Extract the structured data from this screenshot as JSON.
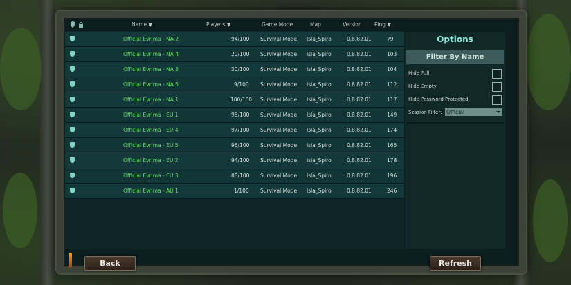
{
  "table": {
    "headers": {
      "name": "Name ▼",
      "players": "Players ▼",
      "game_mode": "Game Mode",
      "map": "Map",
      "version": "Version",
      "ping": "Ping ▼"
    },
    "rows": [
      {
        "name": "Official Evrima - NA 2",
        "players": "94/100",
        "mode": "Survival Mode",
        "map": "Isla_Spiro",
        "version": "0.8.82.01",
        "ping": "79"
      },
      {
        "name": "Official Evrima - NA 4",
        "players": "20/100",
        "mode": "Survival Mode",
        "map": "Isla_Spiro",
        "version": "0.8.82.01",
        "ping": "103"
      },
      {
        "name": "Official Evrima - NA 3",
        "players": "30/100",
        "mode": "Survival Mode",
        "map": "Isla_Spiro",
        "version": "0.8.82.01",
        "ping": "104"
      },
      {
        "name": "Official Evrima - NA 5",
        "players": "9/100",
        "mode": "Survival Mode",
        "map": "Isla_Spiro",
        "version": "0.8.82.01",
        "ping": "112"
      },
      {
        "name": "Official Evrima - NA 1",
        "players": "100/100",
        "mode": "Survival Mode",
        "map": "Isla_Spiro",
        "version": "0.8.82.01",
        "ping": "117"
      },
      {
        "name": "Official Evrima - EU 1",
        "players": "95/100",
        "mode": "Survival Mode",
        "map": "Isla_Spiro",
        "version": "0.8.82.01",
        "ping": "149"
      },
      {
        "name": "Official Evrima - EU 4",
        "players": "97/100",
        "mode": "Survival Mode",
        "map": "Isla_Spiro",
        "version": "0.8.82.01",
        "ping": "174"
      },
      {
        "name": "Official Evrima - EU 5",
        "players": "96/100",
        "mode": "Survival Mode",
        "map": "Isla_Spiro",
        "version": "0.8.82.01",
        "ping": "165"
      },
      {
        "name": "Official Evrima - EU 2",
        "players": "94/100",
        "mode": "Survival Mode",
        "map": "Isla_Spiro",
        "version": "0.8.82.01",
        "ping": "178"
      },
      {
        "name": "Official Evrima - EU 3",
        "players": "88/100",
        "mode": "Survival Mode",
        "map": "Isla_Spiro",
        "version": "0.8.82.01",
        "ping": "196"
      },
      {
        "name": "Official Evrima - AU 1",
        "players": "1/100",
        "mode": "Survival Mode",
        "map": "Isla_Spiro",
        "version": "0.8.82.01",
        "ping": "246"
      }
    ]
  },
  "options": {
    "title": "Options",
    "filter_by_name": "Filter By Name",
    "hide_full": "Hide Full:",
    "hide_empty": "Hide Empty:",
    "hide_password": "Hide Password Protected",
    "session_filter_label": "Session Filter:",
    "session_filter_value": "Official"
  },
  "buttons": {
    "back": "Back",
    "refresh": "Refresh"
  },
  "icons": {
    "shield": "shield-icon",
    "lock": "lock-icon"
  },
  "colors": {
    "server_name": "#5fe05a",
    "panel": "#0e2627",
    "accent": "#8fe6da"
  }
}
